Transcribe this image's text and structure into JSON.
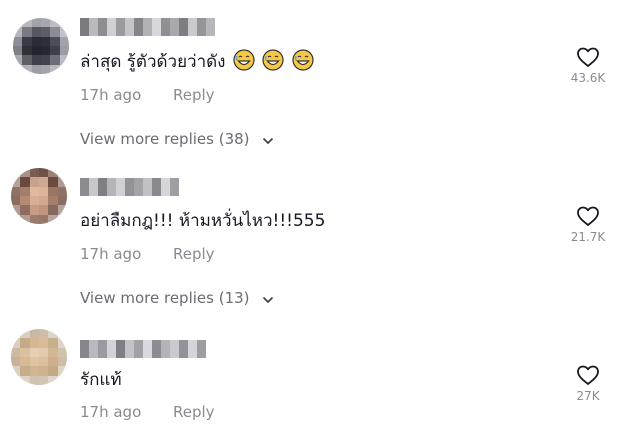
{
  "comments": [
    {
      "text": "ล่าสุด รู้ตัวด้วยว่าดัง",
      "emojis": [
        "grinning-sweat-face",
        "grinning-sweat-face",
        "grinning-sweat-face"
      ],
      "time": "17h ago",
      "reply_label": "Reply",
      "likes": "43.6K",
      "more_replies": "View more replies (38)"
    },
    {
      "text": "อย่าลืมกฎ!!! ห้ามหวั่นไหว!!!555",
      "time": "17h ago",
      "reply_label": "Reply",
      "likes": "21.7K",
      "more_replies": "View more replies (13)"
    },
    {
      "text": "รักแท้",
      "time": "17h ago",
      "reply_label": "Reply",
      "likes": "27K"
    }
  ],
  "icons": {
    "like": "heart-outline-icon",
    "expand": "chevron-down-icon"
  },
  "colors": {
    "muted": "#8a8b91",
    "text": "#161823"
  }
}
